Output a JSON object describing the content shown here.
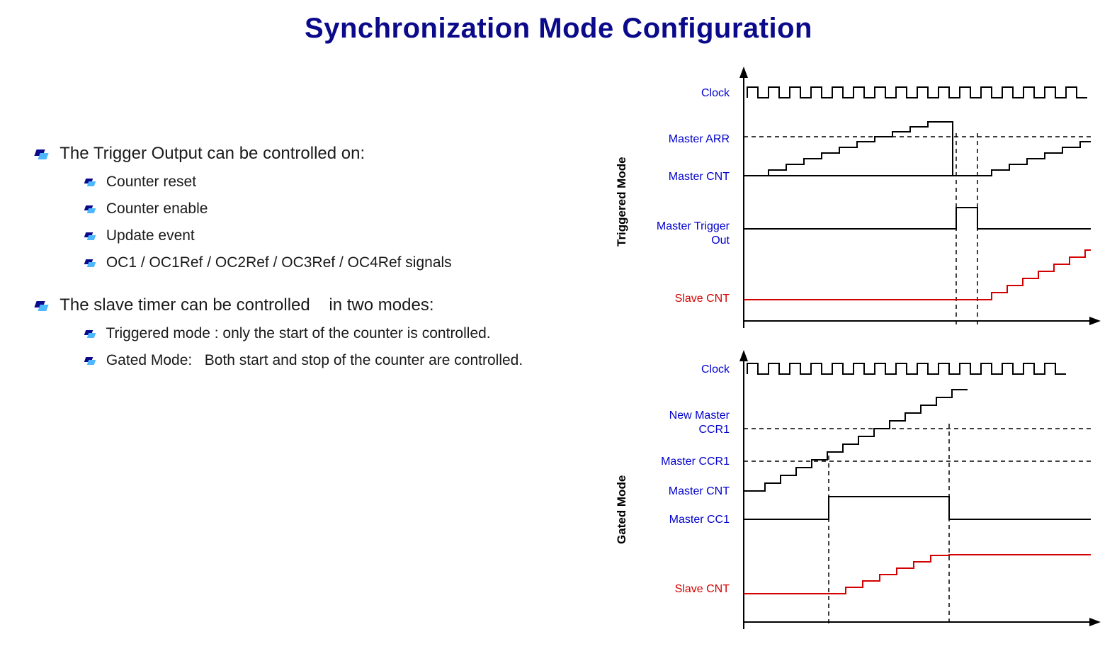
{
  "title": "Synchronization Mode Configuration",
  "left": {
    "section1": {
      "heading": "The Trigger Output can be controlled on:",
      "items": [
        "Counter reset",
        "Counter enable",
        "Update event",
        "OC1 / OC1Ref / OC2Ref / OC3Ref / OC4Ref signals"
      ]
    },
    "section2": {
      "heading": "The slave timer can be controlled    in two modes:",
      "items": [
        "Triggered mode : only the start of the counter is controlled.",
        " Gated Mode:   Both start and stop of the counter are controlled."
      ]
    }
  },
  "diagrams": {
    "triggered": {
      "vlabel": "Triggered Mode",
      "signals": {
        "clock": "Clock",
        "master_arr": "Master ARR",
        "master_cnt": "Master CNT",
        "master_trigger_out_l1": "Master Trigger",
        "master_trigger_out_l2": "Out",
        "slave_cnt": "Slave CNT"
      }
    },
    "gated": {
      "vlabel": "Gated Mode",
      "signals": {
        "clock": "Clock",
        "new_master_ccr1_l1": "New Master",
        "new_master_ccr1_l2": "CCR1",
        "master_ccr1": "Master  CCR1",
        "master_cnt": "Master CNT",
        "master_cc1": "Master CC1",
        "slave_cnt": "Slave  CNT"
      }
    }
  }
}
